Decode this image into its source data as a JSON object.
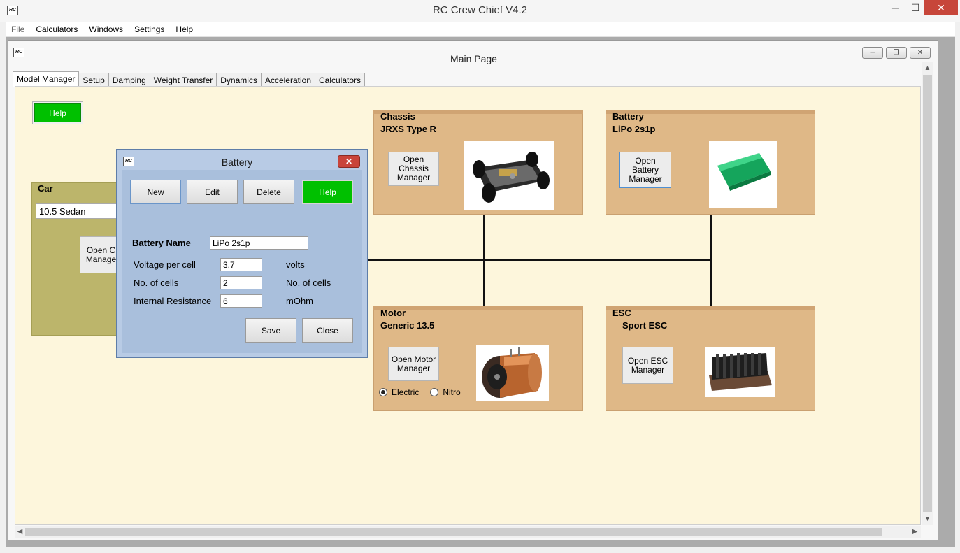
{
  "app": {
    "title": "RC Crew Chief V4.2",
    "icon_label": "RC",
    "controls": {
      "minimize": "─",
      "maximize": "☐",
      "close": "✕"
    }
  },
  "menu": [
    "File",
    "Calculators",
    "Windows",
    "Settings",
    "Help"
  ],
  "child": {
    "title": "Main Page",
    "controls": {
      "minimize": "─",
      "restore": "❐",
      "close": "✕"
    }
  },
  "tabs": [
    "Model Manager",
    "Setup",
    "Damping",
    "Weight Transfer",
    "Dynamics",
    "Acceleration",
    "Calculators"
  ],
  "canvas": {
    "help": "Help",
    "car": {
      "title": "Car",
      "value": "10.5 Sedan",
      "button": "Open C\nManage"
    },
    "chassis": {
      "title": "Chassis",
      "name": "JRXS Type R",
      "button": "Open\nChassis\nManager",
      "image_icon": "rc-chassis-icon"
    },
    "battery": {
      "title": "Battery",
      "name": "LiPo 2s1p",
      "button": "Open\nBattery\nManager",
      "image_icon": "lipo-battery-icon"
    },
    "motor": {
      "title": "Motor",
      "name": "Generic 13.5",
      "button": "Open Motor\nManager",
      "radio_electric": "Electric",
      "radio_nitro": "Nitro",
      "selected": "Electric",
      "image_icon": "brushless-motor-icon"
    },
    "esc": {
      "title": "ESC",
      "name": "Sport ESC",
      "button": "Open ESC\nManager",
      "image_icon": "esc-heatsink-icon"
    }
  },
  "dialog": {
    "title": "Battery",
    "buttons": {
      "new": "New",
      "edit": "Edit",
      "delete": "Delete",
      "help": "Help",
      "save": "Save",
      "close": "Close"
    },
    "name_label": "Battery Name",
    "name_value": "LiPo 2s1p",
    "fields": [
      {
        "label": "Voltage per cell",
        "value": "3.7",
        "unit": "volts"
      },
      {
        "label": "No. of cells",
        "value": "2",
        "unit": "No. of cells"
      },
      {
        "label": "Internal Resistance",
        "value": "6",
        "unit": "mOhm"
      }
    ]
  },
  "colors": {
    "canvas": "#fdf6dc",
    "panel": "#dfb887",
    "car_panel": "#bcb56b",
    "help_green": "#00c000",
    "dialog": "#b8cbe5"
  }
}
